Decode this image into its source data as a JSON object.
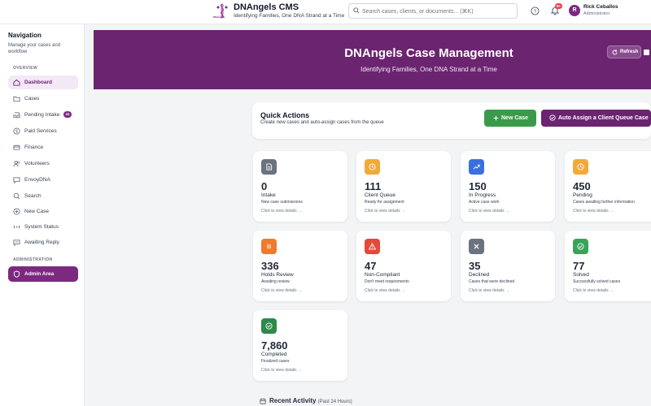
{
  "header": {
    "logo_caption": "DNAngels",
    "app_title": "DNAngels CMS",
    "app_subtitle": "Identifying Families, One DNA Strand at a Time",
    "search_placeholder": "Search cases, clients, or documents... (⌘K)",
    "notification_count": "9+",
    "user_initial": "R",
    "user_name": "Rick Ceballos",
    "user_role": "Administrator"
  },
  "sidebar": {
    "title": "Navigation",
    "subtitle": "Manage your cases and workflow",
    "overview_label": "OVERVIEW",
    "admin_label": "ADMINISTRATION",
    "items": [
      {
        "label": "Dashboard",
        "icon": "home-icon"
      },
      {
        "label": "Cases",
        "icon": "folder-icon"
      },
      {
        "label": "Pending Intake",
        "icon": "inbox-icon",
        "badge": "41"
      },
      {
        "label": "Paid Services",
        "icon": "dollar-icon"
      },
      {
        "label": "Finance",
        "icon": "finance-icon"
      },
      {
        "label": "Volunteers",
        "icon": "users-icon"
      },
      {
        "label": "EnvoyDNA",
        "icon": "chat-icon"
      },
      {
        "label": "Search",
        "icon": "search-icon"
      },
      {
        "label": "New Case",
        "icon": "plus-icon"
      },
      {
        "label": "System Status",
        "icon": "signal-icon"
      },
      {
        "label": "Awaiting Reply",
        "icon": "reply-icon"
      }
    ],
    "admin_item": {
      "label": "Admin Area",
      "icon": "shield-icon"
    }
  },
  "hero": {
    "title": "DNAngels Case Management",
    "subtitle": "Identifying Families, One DNA Strand at a Time",
    "refresh_label": "Refresh"
  },
  "quick_actions": {
    "title": "Quick Actions",
    "subtitle": "Create new cases and auto-assign cases from the queue",
    "new_case_label": "New Case",
    "auto_assign_label": "Auto Assign a Client Queue Case"
  },
  "stats": [
    {
      "value": "0",
      "label": "Intake",
      "desc": "New case submissions",
      "link": "Click to view details →",
      "color": "#6b7280",
      "icon": "document-icon"
    },
    {
      "value": "111",
      "label": "Client Queue",
      "desc": "Ready for assignment",
      "link": "Click to view details →",
      "color": "#f2a93b",
      "icon": "clock-icon"
    },
    {
      "value": "150",
      "label": "In Progress",
      "desc": "Active case work",
      "link": "Click to view details →",
      "color": "#3b6fe0",
      "icon": "trending-up-icon"
    },
    {
      "value": "450",
      "label": "Pending",
      "desc": "Cases awaiting further information",
      "link": "Click to view details →",
      "color": "#f2a93b",
      "icon": "clock-icon"
    },
    {
      "value": "336",
      "label": "Holds Review",
      "desc": "Awaiting review",
      "link": "Click to view details →",
      "color": "#ee7a2e",
      "icon": "pause-icon"
    },
    {
      "value": "47",
      "label": "Non-Compliant",
      "desc": "Don't meet requirements",
      "link": "Click to view details →",
      "color": "#e4483a",
      "icon": "warning-icon"
    },
    {
      "value": "35",
      "label": "Declined",
      "desc": "Cases that were declined",
      "link": "Click to view details →",
      "color": "#6b7280",
      "icon": "x-icon"
    },
    {
      "value": "77",
      "label": "Solved",
      "desc": "Successfully solved cases",
      "link": "Click to view details →",
      "color": "#3aa35a",
      "icon": "check-circle-icon"
    },
    {
      "value": "7,860",
      "label": "Completed",
      "desc": "Finalized cases",
      "link": "Click to view details →",
      "color": "#2f8a4a",
      "icon": "check-circle-icon"
    }
  ],
  "recent": {
    "title": "Recent Activity",
    "subtitle": "(Past 24 Hours)"
  }
}
